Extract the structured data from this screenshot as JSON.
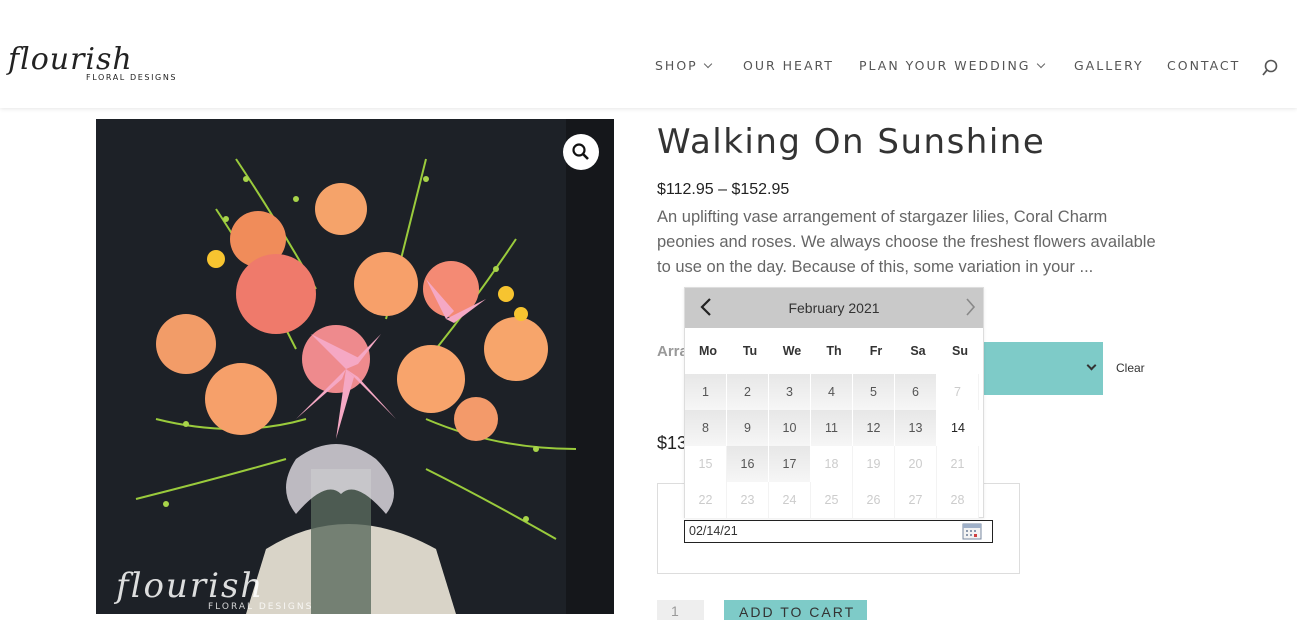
{
  "brand": {
    "script": "flourish",
    "sub": "FLORAL DESIGNS"
  },
  "nav": [
    {
      "label": "SHOP",
      "dropdown": true
    },
    {
      "label": "OUR HEART",
      "dropdown": false
    },
    {
      "label": "PLAN YOUR WEDDING",
      "dropdown": true
    },
    {
      "label": "GALLERY",
      "dropdown": false
    },
    {
      "label": "CONTACT",
      "dropdown": false
    }
  ],
  "product": {
    "title": "Walking On Sunshine",
    "price_range": "$112.95 – $152.95",
    "description": "An uplifting vase arrangement of stargazer lilies, Coral Charm peonies and roses. We always choose the freshest flowers available to use on the day. Because of this, some variation in your ...",
    "variation_label": "Arra",
    "clear_label": "Clear",
    "variation_price": "$13",
    "delivery_date": "02/14/21",
    "quantity": "1",
    "add_to_cart": "ADD TO CART",
    "image_watermark": {
      "script": "flourish",
      "sub": "FLORAL DESIGNS"
    }
  },
  "datepicker": {
    "month_label": "February 2021",
    "weekdays": [
      "Mo",
      "Tu",
      "We",
      "Th",
      "Fr",
      "Sa",
      "Su"
    ],
    "weeks": [
      [
        {
          "d": "1",
          "s": "avail"
        },
        {
          "d": "2",
          "s": "avail"
        },
        {
          "d": "3",
          "s": "avail"
        },
        {
          "d": "4",
          "s": "avail"
        },
        {
          "d": "5",
          "s": "avail"
        },
        {
          "d": "6",
          "s": "avail"
        },
        {
          "d": "7",
          "s": "dis"
        }
      ],
      [
        {
          "d": "8",
          "s": "avail"
        },
        {
          "d": "9",
          "s": "avail"
        },
        {
          "d": "10",
          "s": "avail"
        },
        {
          "d": "11",
          "s": "avail"
        },
        {
          "d": "12",
          "s": "avail"
        },
        {
          "d": "13",
          "s": "avail"
        },
        {
          "d": "14",
          "s": "sel"
        }
      ],
      [
        {
          "d": "15",
          "s": "dis"
        },
        {
          "d": "16",
          "s": "avail"
        },
        {
          "d": "17",
          "s": "avail"
        },
        {
          "d": "18",
          "s": "dis"
        },
        {
          "d": "19",
          "s": "dis"
        },
        {
          "d": "20",
          "s": "dis"
        },
        {
          "d": "21",
          "s": "dis"
        }
      ],
      [
        {
          "d": "22",
          "s": "dis"
        },
        {
          "d": "23",
          "s": "dis"
        },
        {
          "d": "24",
          "s": "dis"
        },
        {
          "d": "25",
          "s": "dis"
        },
        {
          "d": "26",
          "s": "dis"
        },
        {
          "d": "27",
          "s": "dis"
        },
        {
          "d": "28",
          "s": "dis"
        }
      ]
    ]
  },
  "colors": {
    "accent": "#7ecbc8",
    "header_calendar": "#c9c9c9",
    "text": "#333333"
  },
  "icons": {
    "search": "search-icon",
    "zoom": "magnifier-icon",
    "calendar": "calendar-icon"
  }
}
